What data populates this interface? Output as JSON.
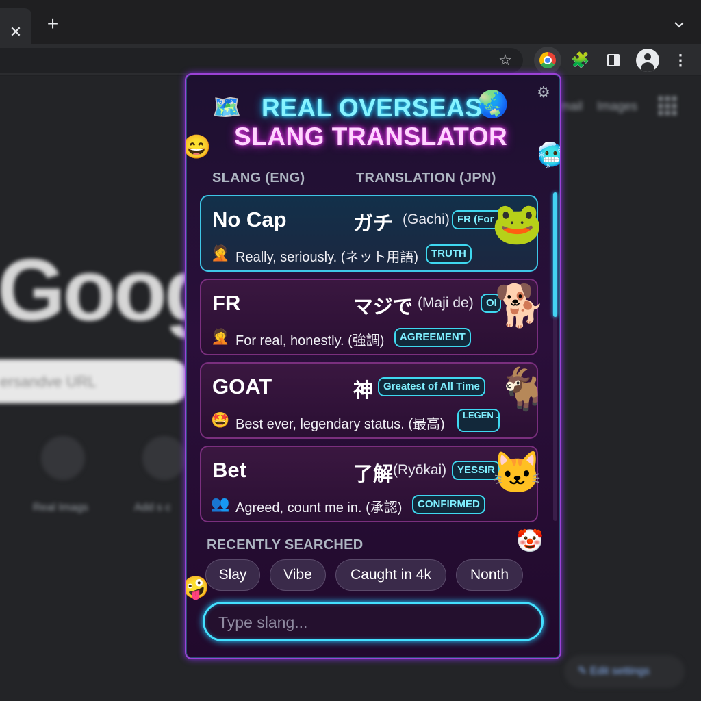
{
  "browser": {
    "tab_close": "✕",
    "new_tab": "+",
    "tab_search": "⌄",
    "star": "☆",
    "puzzle": "🧩",
    "kebab": "⋮"
  },
  "ntp": {
    "logo": "Googl",
    "search_placeholder": "ersandve URL",
    "links": [
      "mail",
      "Images"
    ],
    "shortcuts": [
      {
        "label": "Real Imags"
      },
      {
        "label": "Add s c"
      }
    ],
    "customize": "✎ Edit settings"
  },
  "popup": {
    "title_line1": "REAL OVERSEAS",
    "title_line2": "SLANG TRANSLATOR",
    "icons": {
      "title_left": "🗺️",
      "title_right": "🌏",
      "settings": "⚙"
    },
    "col_slang": "SLANG (ENG)",
    "col_translation": "TRANSLATION (JPN)",
    "cards": [
      {
        "word": "No Cap",
        "jp": "ガチ",
        "romaji": "(Gachi)",
        "tag": "FR (For",
        "desc_emoji": "🤦",
        "desc": "Really, seriously. (ネット用語)",
        "tag2": "TRUTH",
        "sticker": "🐸"
      },
      {
        "word": "FR",
        "jp": "マジで",
        "romaji": "(Maji de)",
        "tag": "OI",
        "desc_emoji": "🤦",
        "desc": "For real, honestly. (強調)",
        "tag2": "AGREEMENT",
        "sticker": "🐕"
      },
      {
        "word": "GOAT",
        "jp": "神",
        "romaji": "",
        "tag": "Greatest of All Time",
        "desc_emoji": "🤩",
        "desc": "Best ever, legendary status. (最高)",
        "tag2": "LEGEN ...DARY",
        "sticker": "🐐"
      },
      {
        "word": "Bet",
        "jp": "了解",
        "romaji": "(Ryōkai)",
        "tag": "YESSIR",
        "desc_emoji": "👥",
        "desc": "Agreed, count me in. (承認)",
        "tag2": "CONFIRMED",
        "sticker": "🐱"
      }
    ],
    "recent_label": "RECENTLY SEARCHED",
    "recent": [
      "Slay",
      "Vibe",
      "Caught in 4k",
      "Nonth"
    ],
    "input_placeholder": "Type slang...",
    "accent_cyan": "#44e0ff",
    "accent_magenta": "#c620d8"
  }
}
